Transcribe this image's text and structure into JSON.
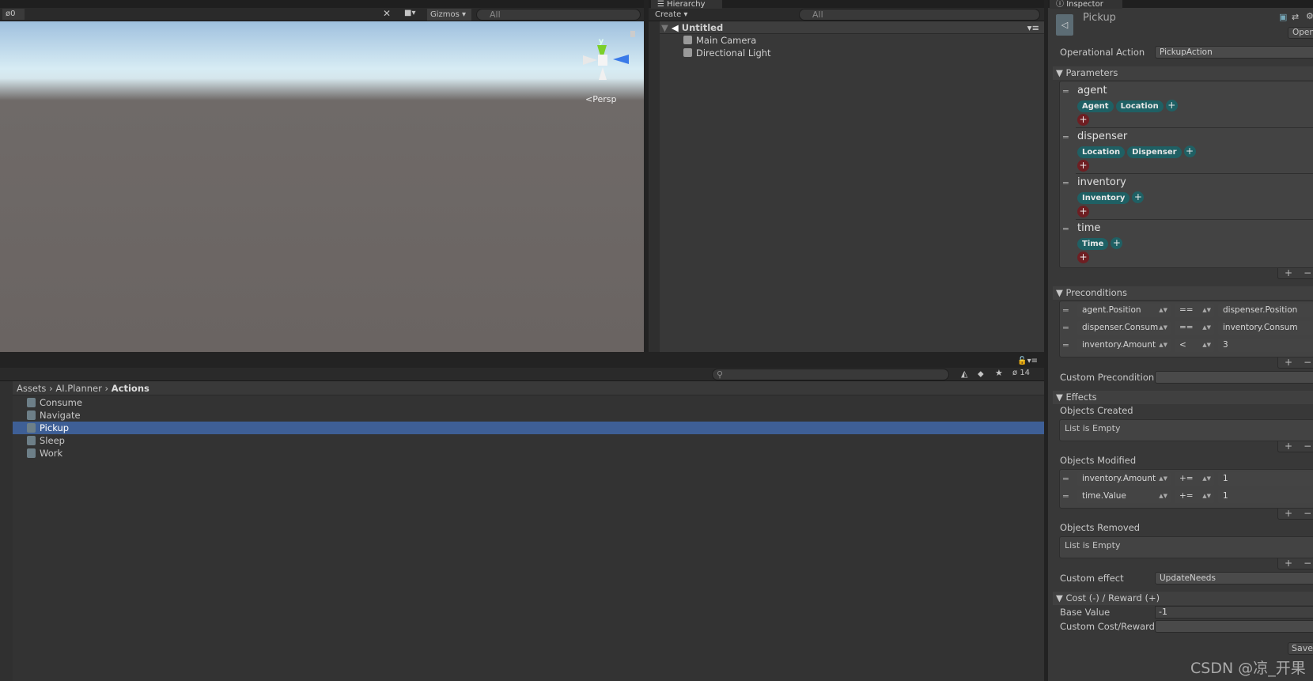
{
  "scene": {
    "hidden_count": "0",
    "gizmos_label": "Gizmos",
    "search_value": "All",
    "persp_label": "Persp",
    "axis_y_label": "y"
  },
  "hierarchy": {
    "tab_title": "Hierarchy",
    "create_label": "Create",
    "search_value": "All",
    "scene_name": "Untitled",
    "items": [
      "Main Camera",
      "Directional Light"
    ]
  },
  "project": {
    "hidden_count": "14",
    "breadcrumb": [
      "Assets",
      "AI.Planner",
      "Actions"
    ],
    "items": [
      {
        "label": "Consume",
        "selected": false
      },
      {
        "label": "Navigate",
        "selected": false
      },
      {
        "label": "Pickup",
        "selected": true
      },
      {
        "label": "Sleep",
        "selected": false
      },
      {
        "label": "Work",
        "selected": false
      }
    ],
    "selection_color": "#3e5f96"
  },
  "inspector": {
    "tab_title": "Inspector",
    "asset_name": "Pickup",
    "open_label": "Open",
    "operational_action_label": "Operational Action",
    "operational_action_value": "PickupAction",
    "parameters_label": "Parameters",
    "parameters": [
      {
        "name": "agent",
        "traits": [
          "Agent",
          "Location"
        ]
      },
      {
        "name": "dispenser",
        "traits": [
          "Location",
          "Dispenser"
        ]
      },
      {
        "name": "inventory",
        "traits": [
          "Inventory"
        ]
      },
      {
        "name": "time",
        "traits": [
          "Time"
        ]
      }
    ],
    "preconditions_label": "Preconditions",
    "preconditions": [
      {
        "left": "agent.Position",
        "op": "==",
        "right": "dispenser.Position"
      },
      {
        "left": "dispenser.Consum",
        "op": "==",
        "right": "inventory.Consum"
      },
      {
        "left": "inventory.Amount",
        "op": "<",
        "right": "3"
      }
    ],
    "custom_precondition_label": "Custom Precondition",
    "custom_precondition_value": "",
    "effects_label": "Effects",
    "objects_created_label": "Objects Created",
    "objects_created_empty": "List is Empty",
    "objects_modified_label": "Objects Modified",
    "objects_modified": [
      {
        "left": "inventory.Amount",
        "op": "+=",
        "right": "1"
      },
      {
        "left": "time.Value",
        "op": "+=",
        "right": "1"
      }
    ],
    "objects_removed_label": "Objects Removed",
    "objects_removed_empty": "List is Empty",
    "custom_effect_label": "Custom effect",
    "custom_effect_value": "UpdateNeeds",
    "cost_label": "Cost (-) / Reward (+)",
    "base_value_label": "Base Value",
    "base_value": "-1",
    "custom_cost_label": "Custom Cost/Reward",
    "custom_cost_value": "",
    "save_label": "Save",
    "trait_chip_color": "#1f6064",
    "remove_color": "#6e1e22"
  },
  "watermark": "CSDN @凉_开果"
}
